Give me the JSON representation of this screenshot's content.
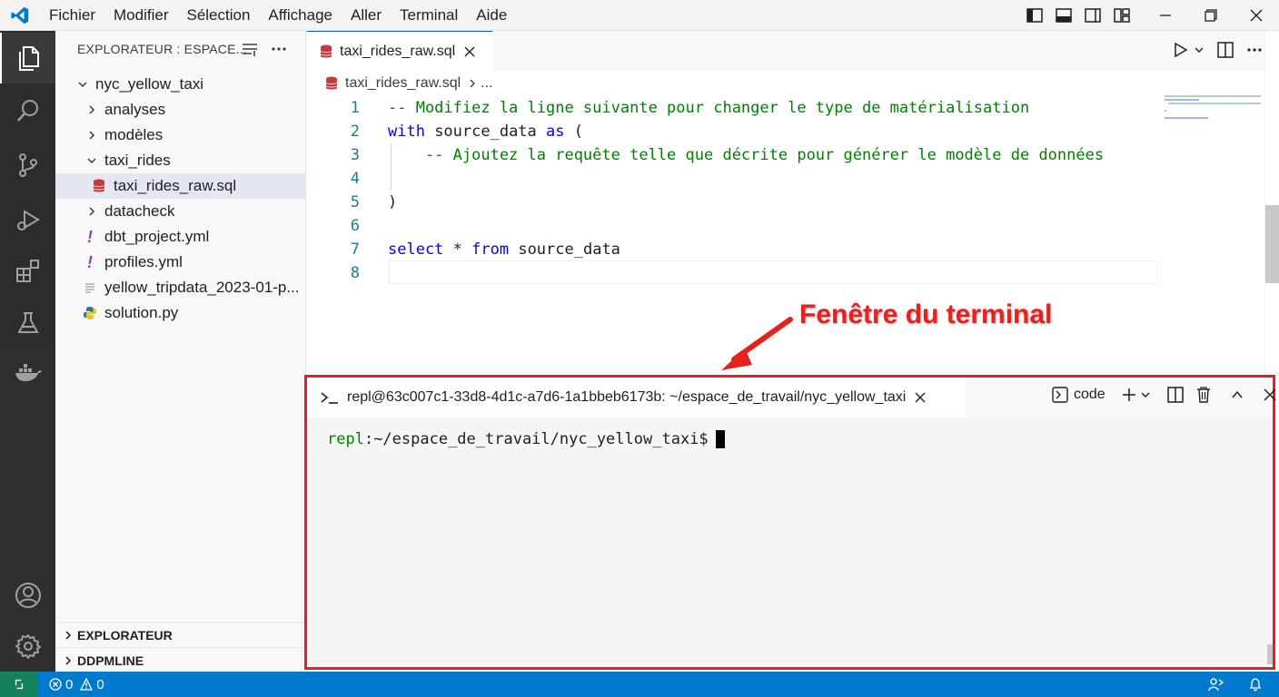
{
  "menu": [
    "Fichier",
    "Modifier",
    "Sélection",
    "Affichage",
    "Aller",
    "Terminal",
    "Aide"
  ],
  "explorer": {
    "header": "EXPLORATEUR : ESPACE...",
    "root": "nyc_yellow_taxi",
    "items": [
      {
        "label": "analyses",
        "type": "folder",
        "open": false
      },
      {
        "label": "modèles",
        "type": "folder",
        "open": false
      },
      {
        "label": "taxi_rides",
        "type": "folder",
        "open": true
      },
      {
        "label": "taxi_rides_raw.sql",
        "type": "sql",
        "selected": true
      },
      {
        "label": "datacheck",
        "type": "folder",
        "open": false
      },
      {
        "label": "dbt_project.yml",
        "type": "yml"
      },
      {
        "label": "profiles.yml",
        "type": "yml"
      },
      {
        "label": "yellow_tripdata_2023-01-p...",
        "type": "text"
      },
      {
        "label": "solution.py",
        "type": "python"
      }
    ],
    "yml_glyph": "!",
    "sections": [
      "EXPLORATEUR",
      "DDPMLINE"
    ]
  },
  "editor": {
    "tab_label": "taxi_rides_raw.sql",
    "breadcrumb_file": "taxi_rides_raw.sql",
    "breadcrumb_more": "...",
    "lines": [
      {
        "n": "1",
        "parts": [
          {
            "t": "-- Modifiez la ligne suivante pour changer le type de matérialisation",
            "c": "cmt"
          }
        ]
      },
      {
        "n": "2",
        "parts": [
          {
            "t": "with",
            "c": "kw"
          },
          {
            "t": " source_data ",
            "c": ""
          },
          {
            "t": "as",
            "c": "kw"
          },
          {
            "t": " (",
            "c": ""
          }
        ]
      },
      {
        "n": "3",
        "parts": [
          {
            "t": "    -- Ajoutez la requête telle que décrite pour générer le modèle de données",
            "c": "cmt"
          }
        ]
      },
      {
        "n": "4",
        "parts": []
      },
      {
        "n": "5",
        "parts": [
          {
            "t": ")",
            "c": ""
          }
        ]
      },
      {
        "n": "6",
        "parts": []
      },
      {
        "n": "7",
        "parts": [
          {
            "t": "select",
            "c": "kw"
          },
          {
            "t": " * ",
            "c": ""
          },
          {
            "t": "from",
            "c": "kw"
          },
          {
            "t": " source_data",
            "c": ""
          }
        ]
      },
      {
        "n": "8",
        "parts": []
      }
    ]
  },
  "annotation": "Fenêtre du terminal",
  "terminal": {
    "tab_label": "repl@63c007c1-33d8-4d1c-a7d6-1a1bbeb6173b: ~/espace_de_travail/nyc_yellow_taxi",
    "shell_label": "code",
    "prompt_user": "repl",
    "prompt_path": ":~/espace_de_travail/nyc_yellow_taxi$"
  },
  "status": {
    "errors": "0",
    "warnings": "0"
  },
  "colors": {
    "accent": "#007acc",
    "annotation": "#e8211d",
    "sql_icon": "#c33c3c",
    "yml_icon": "#8a44b8"
  }
}
